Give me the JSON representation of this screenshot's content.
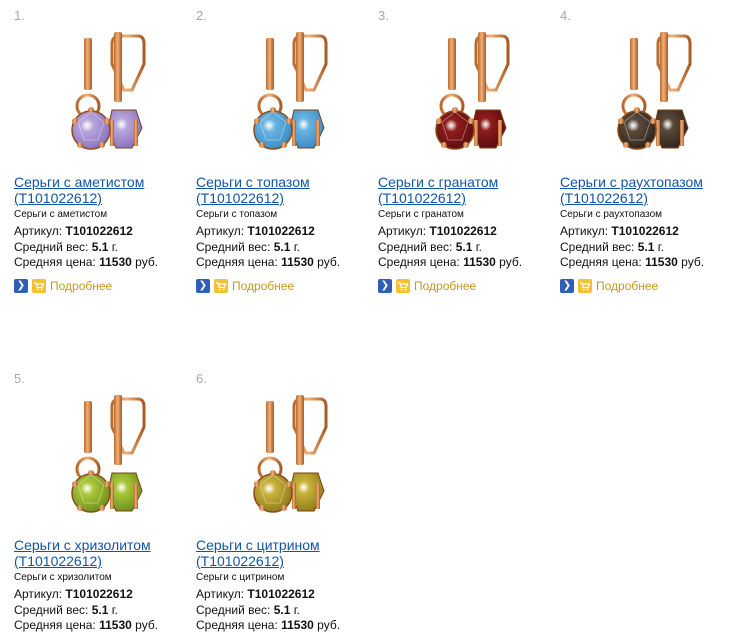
{
  "detail_label": "Подробнее",
  "labels": {
    "article": "Артикул:",
    "weight": "Средний вес:",
    "price": "Средняя цена:"
  },
  "units": {
    "weight": "г.",
    "price": "руб."
  },
  "products": [
    {
      "number": "1.",
      "title": "Серьги с аметистом (Т101022612)",
      "subtitle": "Серьги с аметистом",
      "article": "Т101022612",
      "weight": "5.1",
      "price": "11530",
      "stone_color": "#b9a6dc",
      "stone_dark": "#8b72bd"
    },
    {
      "number": "2.",
      "title": "Серьги с топазом (Т101022612)",
      "subtitle": "Серьги с топазом",
      "article": "Т101022612",
      "weight": "5.1",
      "price": "11530",
      "stone_color": "#6ab4e2",
      "stone_dark": "#3a8cc4"
    },
    {
      "number": "3.",
      "title": "Серьги с гранатом (Т101022612)",
      "subtitle": "Серьги с гранатом",
      "article": "Т101022612",
      "weight": "5.1",
      "price": "11530",
      "stone_color": "#8e1c1c",
      "stone_dark": "#5c0d0d"
    },
    {
      "number": "4.",
      "title": "Серьги с раухтопазом (Т101022612)",
      "subtitle": "Серьги с раухтопазом",
      "article": "Т101022612",
      "weight": "5.1",
      "price": "11530",
      "stone_color": "#5b4a3a",
      "stone_dark": "#2e241b"
    },
    {
      "number": "5.",
      "title": "Серьги с хризолитом (Т101022612)",
      "subtitle": "Серьги с хризолитом",
      "article": "Т101022612",
      "weight": "5.1",
      "price": "11530",
      "stone_color": "#a9c93a",
      "stone_dark": "#6f8f1c"
    },
    {
      "number": "6.",
      "title": "Серьги с цитрином (Т101022612)",
      "subtitle": "Серьги с цитрином",
      "article": "Т101022612",
      "weight": "5.1",
      "price": "11530",
      "stone_color": "#c9b33a",
      "stone_dark": "#8f7a1c"
    }
  ]
}
